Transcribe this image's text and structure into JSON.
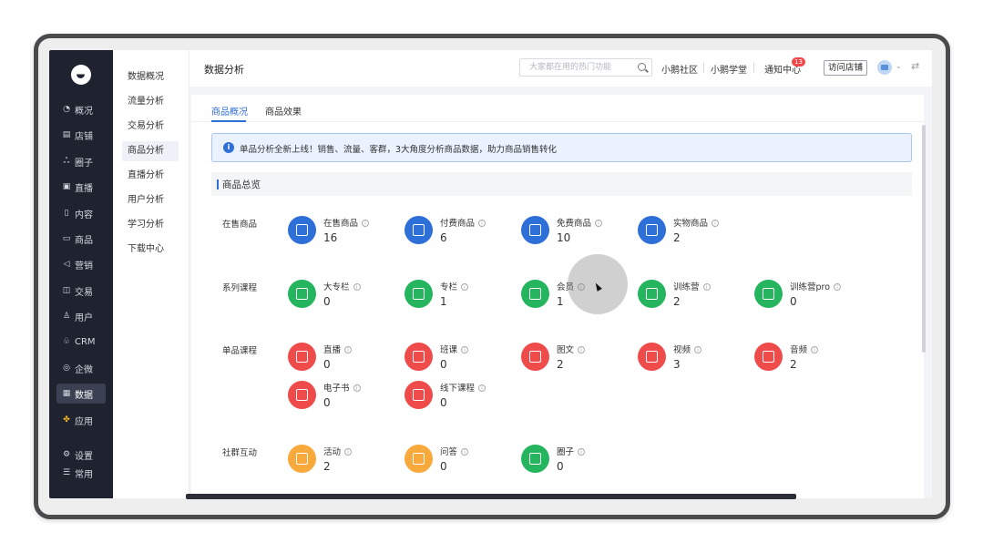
{
  "sidebar": {
    "items": [
      {
        "label": "概况",
        "icon": "clock-icon"
      },
      {
        "label": "店铺",
        "icon": "store-icon"
      },
      {
        "label": "圈子",
        "icon": "group-icon"
      },
      {
        "label": "直播",
        "icon": "live-icon"
      },
      {
        "label": "内容",
        "icon": "document-icon"
      },
      {
        "label": "商品",
        "icon": "product-icon"
      },
      {
        "label": "营销",
        "icon": "megaphone-icon"
      },
      {
        "label": "交易",
        "icon": "trade-icon"
      },
      {
        "label": "用户",
        "icon": "user-icon"
      },
      {
        "label": "CRM",
        "icon": "crm-icon"
      },
      {
        "label": "企微",
        "icon": "wecom-icon"
      },
      {
        "label": "数据",
        "icon": "data-icon"
      },
      {
        "label": "应用",
        "icon": "apps-icon"
      }
    ],
    "bottom": [
      {
        "label": "设置",
        "icon": "gear-icon"
      },
      {
        "label": "常用",
        "icon": "list-icon"
      }
    ],
    "active": "数据"
  },
  "subnav": {
    "items": [
      "数据概况",
      "流量分析",
      "交易分析",
      "商品分析",
      "直播分析",
      "用户分析",
      "学习分析",
      "下载中心"
    ],
    "active": "商品分析"
  },
  "header": {
    "title": "数据分析",
    "search_placeholder": "大家都在用的热门功能",
    "links": [
      "小鹅社区",
      "小鹅学堂",
      "通知中心"
    ],
    "notification_count": "13",
    "visit_button": "访问店铺"
  },
  "tabs": [
    "商品概况",
    "商品效果"
  ],
  "notice": "单品分析全新上线！销售、流量、客群，3大角度分析商品数据，助力商品销售转化",
  "section_title": "商品总览",
  "groups": [
    {
      "label": "在售商品",
      "items": [
        {
          "name": "在售商品",
          "value": "16",
          "color": "blue"
        },
        {
          "name": "付费商品",
          "value": "6",
          "color": "blue"
        },
        {
          "name": "免费商品",
          "value": "10",
          "color": "blue"
        },
        {
          "name": "实物商品",
          "value": "2",
          "color": "blue"
        }
      ]
    },
    {
      "label": "系列课程",
      "items": [
        {
          "name": "大专栏",
          "value": "0",
          "color": "green"
        },
        {
          "name": "专栏",
          "value": "1",
          "color": "green"
        },
        {
          "name": "会员",
          "value": "1",
          "color": "green"
        },
        {
          "name": "训练营",
          "value": "2",
          "color": "green"
        },
        {
          "name": "训练营pro",
          "value": "0",
          "color": "green"
        }
      ]
    },
    {
      "label": "单品课程",
      "items": [
        {
          "name": "直播",
          "value": "0",
          "color": "red"
        },
        {
          "name": "班课",
          "value": "0",
          "color": "red"
        },
        {
          "name": "图文",
          "value": "2",
          "color": "red"
        },
        {
          "name": "视频",
          "value": "3",
          "color": "red"
        },
        {
          "name": "音频",
          "value": "2",
          "color": "red"
        },
        {
          "name": "电子书",
          "value": "0",
          "color": "red"
        },
        {
          "name": "线下课程",
          "value": "0",
          "color": "red"
        }
      ]
    },
    {
      "label": "社群互动",
      "items": [
        {
          "name": "活动",
          "value": "2",
          "color": "orange"
        },
        {
          "name": "问答",
          "value": "0",
          "color": "orange"
        },
        {
          "name": "圈子",
          "value": "0",
          "color": "green"
        }
      ]
    }
  ],
  "colors": {
    "accent": "#2f6fd8",
    "sidebar": "#1f2330",
    "blue": "#2f6fd8",
    "green": "#25b55f",
    "red": "#ef4b4b",
    "orange": "#f7a93b"
  }
}
